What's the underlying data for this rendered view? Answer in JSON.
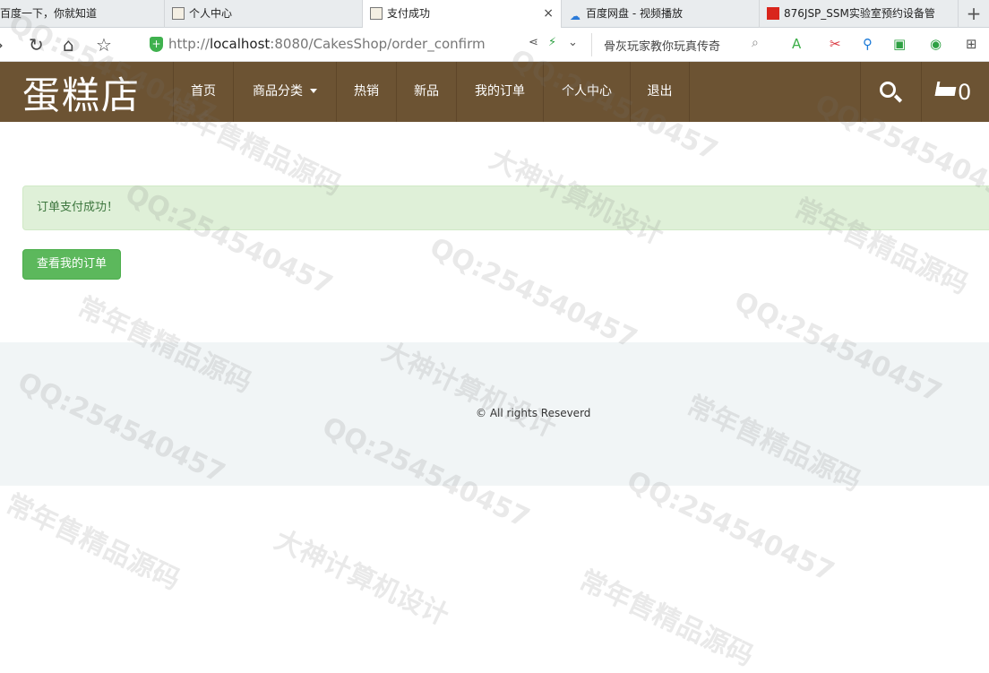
{
  "browser": {
    "tabs": [
      {
        "label": "百度一下，你就知道",
        "active": false
      },
      {
        "label": "个人中心",
        "active": false
      },
      {
        "label": "支付成功",
        "active": true,
        "close": "×"
      },
      {
        "label": "百度网盘 - 视频播放",
        "active": false
      },
      {
        "label": "876JSP_SSM实验室预约设备管",
        "active": false
      }
    ],
    "new_tab": "+",
    "address": {
      "prefix": "http://",
      "host": "localhost",
      "rest": ":8080/CakesShop/order_confirm"
    },
    "search_text": "骨灰玩家教你玩真传奇"
  },
  "site": {
    "brand": "蛋糕店",
    "nav": [
      {
        "label": "首页"
      },
      {
        "label": "商品分类",
        "dropdown": true
      },
      {
        "label": "热销"
      },
      {
        "label": "新品"
      },
      {
        "label": "我的订单"
      },
      {
        "label": "个人中心"
      },
      {
        "label": "退出"
      }
    ],
    "cart_count": "0",
    "colors": {
      "navbar": "#6c5333",
      "alert_bg": "#dff0d8",
      "button": "#5cb85c",
      "footer_bg": "#f1f5f6"
    }
  },
  "main": {
    "alert_text": "订单支付成功！",
    "view_orders_button": "查看我的订单"
  },
  "footer": {
    "copyright": "© All rights Reseverd"
  },
  "watermarks": {
    "qq": "QQ:254540457",
    "shop": "常年售精品源码",
    "design": "大神计算机设计"
  }
}
